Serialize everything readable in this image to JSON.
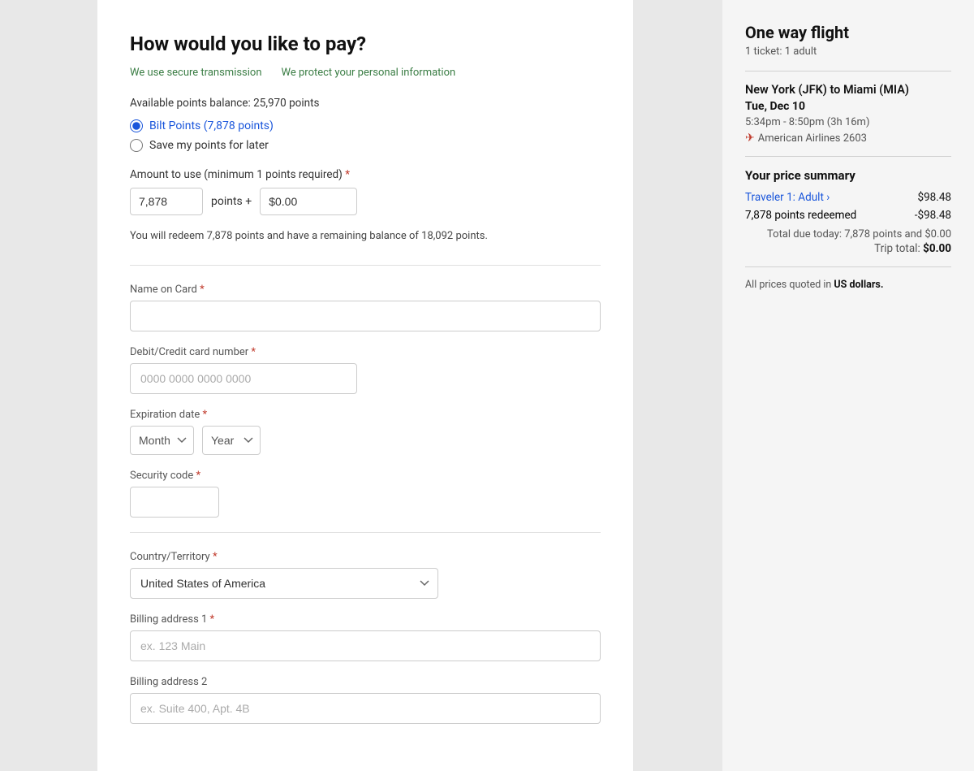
{
  "page": {
    "title": "How would you like to pay?"
  },
  "secure_links": [
    {
      "label": "We use secure transmission"
    },
    {
      "label": "We protect your personal information"
    }
  ],
  "points": {
    "balance_label": "Available points balance: 25,970 points",
    "radio_bilt": "Bilt Points (7,878 points)",
    "radio_save": "Save my points for later",
    "amount_label": "Amount to use (minimum 1 points required)",
    "amount_value": "7,878",
    "points_plus_label": "points +",
    "dollar_value": "$0.00",
    "redeem_note": "You will redeem 7,878 points and have a remaining balance of 18,092 points."
  },
  "form": {
    "name_on_card_label": "Name on Card",
    "name_required": true,
    "card_number_label": "Debit/Credit card number",
    "card_number_required": true,
    "card_number_placeholder": "0000 0000 0000 0000",
    "expiration_label": "Expiration date",
    "expiration_required": true,
    "month_label": "Month",
    "year_label": "Year",
    "security_label": "Security code",
    "security_required": true,
    "country_label": "Country/Territory",
    "country_required": true,
    "country_value": "United States of America",
    "billing1_label": "Billing address 1",
    "billing1_required": true,
    "billing1_placeholder": "ex. 123 Main",
    "billing2_label": "Billing address 2",
    "billing2_placeholder": "ex. Suite 400, Apt. 4B"
  },
  "sidebar": {
    "flight_type": "One way flight",
    "ticket_info": "1 ticket: 1 adult",
    "route": "New York (JFK) to Miami (MIA)",
    "date": "Tue, Dec 10",
    "time": "5:34pm - 8:50pm (3h 16m)",
    "airline": "American Airlines 2603",
    "price_summary_title": "Your price summary",
    "traveler_label": "Traveler 1: Adult",
    "traveler_chevron": "›",
    "base_price": "$98.48",
    "points_redeemed_label": "7,878 points redeemed",
    "points_discount": "-$98.48",
    "total_due_label": "Total due today: 7,878 points and $0.00",
    "trip_total_label": "Trip total:",
    "trip_total_amount": "$0.00",
    "currency_note": "All prices quoted in",
    "currency_bold": "US dollars."
  }
}
